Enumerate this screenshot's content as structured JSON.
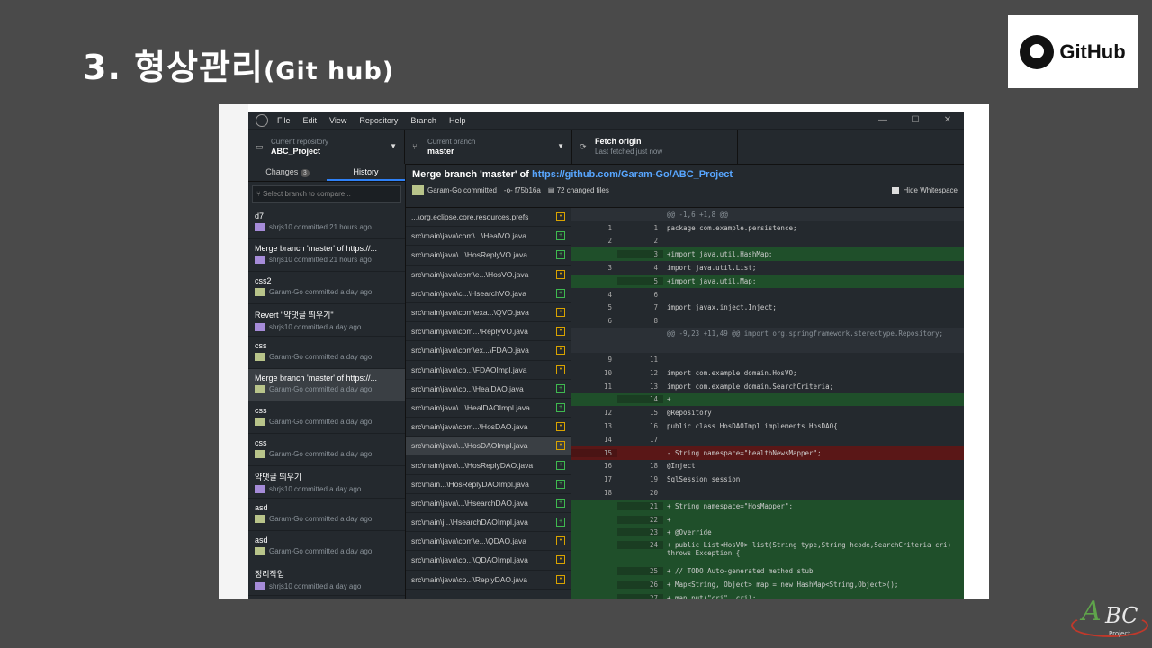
{
  "slide": {
    "title": "3. 형상관리",
    "subtitle": "(Git hub)"
  },
  "logo": {
    "text": "GitHub"
  },
  "menu": [
    "File",
    "Edit",
    "View",
    "Repository",
    "Branch",
    "Help"
  ],
  "toolbar": {
    "repo_label": "Current repository",
    "repo_value": "ABC_Project",
    "branch_label": "Current branch",
    "branch_value": "master",
    "fetch_label": "Fetch origin",
    "fetch_value": "Last fetched just now"
  },
  "tabs": {
    "changes": "Changes",
    "changes_count": "3",
    "history": "History"
  },
  "filter_placeholder": "Select branch to compare...",
  "commits": [
    {
      "title": "d7",
      "sub": "shrjs10 committed 21 hours ago",
      "av": "p"
    },
    {
      "title": "Merge branch 'master' of https://...",
      "sub": "shrjs10 committed 21 hours ago",
      "av": "p"
    },
    {
      "title": "css2",
      "sub": "Garam-Go committed a day ago",
      "av": "g"
    },
    {
      "title": "Revert \"약댓글 띄우기\"",
      "sub": "shrjs10 committed a day ago",
      "av": "p"
    },
    {
      "title": "css",
      "sub": "Garam-Go committed a day ago",
      "av": "g"
    },
    {
      "title": "Merge branch 'master' of https://...",
      "sub": "Garam-Go committed a day ago",
      "av": "g",
      "sel": true
    },
    {
      "title": "css",
      "sub": "Garam-Go committed a day ago",
      "av": "g"
    },
    {
      "title": "css",
      "sub": "Garam-Go committed a day ago",
      "av": "g"
    },
    {
      "title": "약댓글 띄우기",
      "sub": "shrjs10 committed a day ago",
      "av": "p"
    },
    {
      "title": "asd",
      "sub": "Garam-Go committed a day ago",
      "av": "g"
    },
    {
      "title": "asd",
      "sub": "Garam-Go committed a day ago",
      "av": "g"
    },
    {
      "title": "정리작업",
      "sub": "shrjs10 committed a day ago",
      "av": "p"
    }
  ],
  "commit_header": {
    "title": "Merge branch 'master' of ",
    "link": "https://github.com/Garam-Go/ABC_Project",
    "author": "Garam-Go committed",
    "sha": "f75b16a",
    "changed": "72 changed files",
    "hide_ws": "Hide Whitespace"
  },
  "files": [
    {
      "name": "...\\org.eclipse.core.resources.prefs",
      "status": "mod"
    },
    {
      "name": "src\\main\\java\\com\\...\\HealVO.java",
      "status": "add"
    },
    {
      "name": "src\\main\\java\\...\\HosReplyVO.java",
      "status": "add"
    },
    {
      "name": "src\\main\\java\\com\\e...\\HosVO.java",
      "status": "mod"
    },
    {
      "name": "src\\main\\java\\c...\\HsearchVO.java",
      "status": "add"
    },
    {
      "name": "src\\main\\java\\com\\exa...\\QVO.java",
      "status": "mod"
    },
    {
      "name": "src\\main\\java\\com...\\ReplyVO.java",
      "status": "mod"
    },
    {
      "name": "src\\main\\java\\com\\ex...\\FDAO.java",
      "status": "mod"
    },
    {
      "name": "src\\main\\java\\co...\\FDAOImpl.java",
      "status": "mod"
    },
    {
      "name": "src\\main\\java\\co...\\HealDAO.java",
      "status": "add"
    },
    {
      "name": "src\\main\\java\\...\\HealDAOImpl.java",
      "status": "add"
    },
    {
      "name": "src\\main\\java\\com...\\HosDAO.java",
      "status": "mod"
    },
    {
      "name": "src\\main\\java\\...\\HosDAOImpl.java",
      "status": "mod",
      "sel": true
    },
    {
      "name": "src\\main\\java\\...\\HosReplyDAO.java",
      "status": "add"
    },
    {
      "name": "src\\main...\\HosReplyDAOImpl.java",
      "status": "add"
    },
    {
      "name": "src\\main\\java\\...\\HsearchDAO.java",
      "status": "add"
    },
    {
      "name": "src\\main\\j...\\HsearchDAOImpl.java",
      "status": "add"
    },
    {
      "name": "src\\main\\java\\com\\e...\\QDAO.java",
      "status": "mod"
    },
    {
      "name": "src\\main\\java\\co...\\QDAOImpl.java",
      "status": "mod"
    },
    {
      "name": "src\\main\\java\\co...\\ReplyDAO.java",
      "status": "mod"
    }
  ],
  "diff": [
    {
      "t": "hunk",
      "n1": "",
      "n2": "",
      "c": "@@ -1,6 +1,8 @@"
    },
    {
      "t": "ctx",
      "n1": "1",
      "n2": "1",
      "c": " package com.example.persistence;"
    },
    {
      "t": "ctx",
      "n1": "2",
      "n2": "2",
      "c": ""
    },
    {
      "t": "add",
      "n1": "",
      "n2": "3",
      "c": "+import java.util.HashMap;"
    },
    {
      "t": "ctx",
      "n1": "3",
      "n2": "4",
      "c": " import java.util.List;"
    },
    {
      "t": "add",
      "n1": "",
      "n2": "5",
      "c": "+import java.util.Map;"
    },
    {
      "t": "ctx",
      "n1": "4",
      "n2": "6",
      "c": ""
    },
    {
      "t": "ctx",
      "n1": "5",
      "n2": "7",
      "c": " import javax.inject.Inject;"
    },
    {
      "t": "ctx",
      "n1": "6",
      "n2": "8",
      "c": ""
    },
    {
      "t": "hunk",
      "n1": "",
      "n2": "",
      "c": "@@ -9,23 +11,49 @@ import org.springframework.stereotype.Repository;",
      "tall": true
    },
    {
      "t": "ctx",
      "n1": "9",
      "n2": "11",
      "c": ""
    },
    {
      "t": "ctx",
      "n1": "10",
      "n2": "12",
      "c": " import com.example.domain.HosVO;"
    },
    {
      "t": "ctx",
      "n1": "11",
      "n2": "13",
      "c": " import com.example.domain.SearchCriteria;"
    },
    {
      "t": "add",
      "n1": "",
      "n2": "14",
      "c": "+"
    },
    {
      "t": "ctx",
      "n1": "12",
      "n2": "15",
      "c": " @Repository"
    },
    {
      "t": "ctx",
      "n1": "13",
      "n2": "16",
      "c": " public class HosDAOImpl implements HosDAO{"
    },
    {
      "t": "ctx",
      "n1": "14",
      "n2": "17",
      "c": ""
    },
    {
      "t": "del",
      "n1": "15",
      "n2": "",
      "c": "-    String namespace=\"healthNewsMapper\";"
    },
    {
      "t": "ctx",
      "n1": "16",
      "n2": "18",
      "c": "     @Inject"
    },
    {
      "t": "ctx",
      "n1": "17",
      "n2": "19",
      "c": "     SqlSession session;"
    },
    {
      "t": "ctx",
      "n1": "18",
      "n2": "20",
      "c": ""
    },
    {
      "t": "add",
      "n1": "",
      "n2": "21",
      "c": "+    String namespace=\"HosMapper\";"
    },
    {
      "t": "add",
      "n1": "",
      "n2": "22",
      "c": "+"
    },
    {
      "t": "add",
      "n1": "",
      "n2": "23",
      "c": "+    @Override"
    },
    {
      "t": "add",
      "n1": "",
      "n2": "24",
      "c": "+    public List<HosVO> list(String type,String hcode,SearchCriteria cri) throws Exception {",
      "tall": true
    },
    {
      "t": "add",
      "n1": "",
      "n2": "25",
      "c": "+        // TODO Auto-generated method stub"
    },
    {
      "t": "add",
      "n1": "",
      "n2": "26",
      "c": "+        Map<String, Object> map = new HashMap<String,Object>();"
    },
    {
      "t": "add",
      "n1": "",
      "n2": "27",
      "c": "+        map.put(\"cri\", cri);"
    }
  ],
  "watermark": {
    "a": "A",
    "bc": "BC",
    "project": "Project"
  }
}
